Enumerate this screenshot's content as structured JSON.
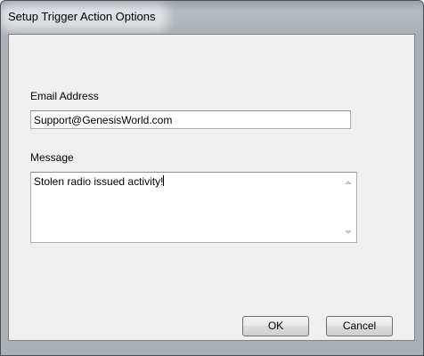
{
  "window": {
    "title": "Setup Trigger Action Options"
  },
  "form": {
    "email_label": "Email Address",
    "email_value": "Support@GenesisWorld.com",
    "message_label": "Message",
    "message_value": "Stolen radio issued activity!"
  },
  "buttons": {
    "ok_label": "OK",
    "cancel_label": "Cancel"
  },
  "icons": {
    "scroll_up": "scroll-up-arrow",
    "scroll_down": "scroll-down-arrow"
  }
}
